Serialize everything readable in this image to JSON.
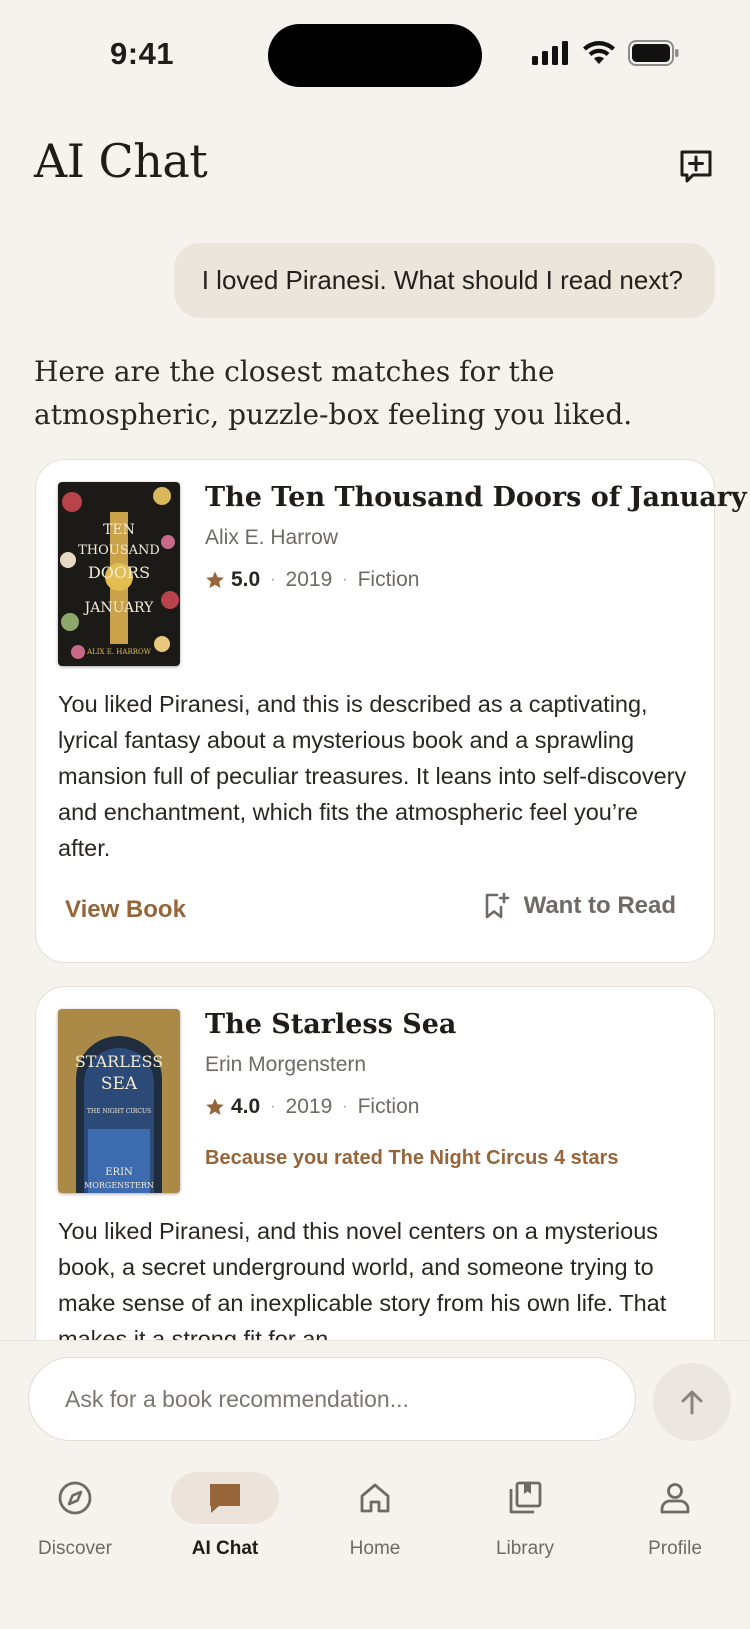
{
  "status": {
    "time": "9:41"
  },
  "header": {
    "title": "AI Chat",
    "new_chat_icon": "new-chat-icon"
  },
  "conversation": {
    "user_message": "I loved Piranesi. What should I read next?",
    "ai_intro": "Here are the closest matches for the atmospheric, puzzle-box feeling you liked."
  },
  "books": [
    {
      "title": "The Ten Thousand Doors of January",
      "author": "Alix E. Harrow",
      "rating": "5.0",
      "year": "2019",
      "genre": "Fiction",
      "description": "You liked Piranesi, and this is described as a captivating, lyrical fantasy about a mysterious book and a sprawling mansion full of peculiar treasures. It leans into self-discovery and enchantment, which fits the atmospheric feel you’re after.",
      "view_label": "View Book",
      "want_label": "Want to Read"
    },
    {
      "title": "The Starless Sea",
      "author": "Erin Morgenstern",
      "rating": "4.0",
      "year": "2019",
      "genre": "Fiction",
      "reason": "Because you rated The Night Circus 4 stars",
      "description": "You liked Piranesi, and this novel centers on a mysterious book, a secret underground world, and someone trying to make sense of an inexplicable story from his own life. That makes it a strong fit for an"
    }
  ],
  "composer": {
    "placeholder": "Ask for a book recommendation..."
  },
  "tabs": [
    {
      "label": "Discover",
      "icon": "compass-icon"
    },
    {
      "label": "AI Chat",
      "icon": "chat-icon"
    },
    {
      "label": "Home",
      "icon": "home-icon"
    },
    {
      "label": "Library",
      "icon": "library-icon"
    },
    {
      "label": "Profile",
      "icon": "profile-icon"
    }
  ],
  "colors": {
    "accent": "#96663a",
    "background": "#f6f3ee",
    "active_tab_bg": "#ece4da"
  }
}
